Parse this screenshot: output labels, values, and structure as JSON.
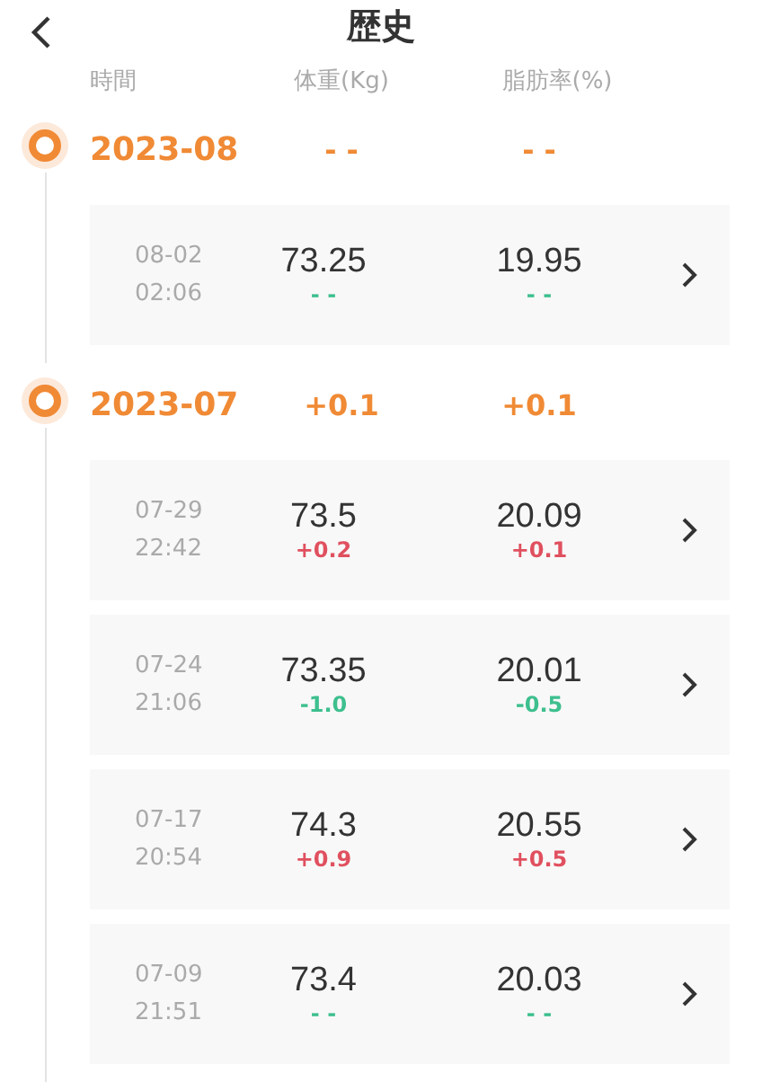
{
  "header": {
    "title": "歴史"
  },
  "columns": [
    "時間",
    "体重(Kg)",
    "脂肪率(%)"
  ],
  "months": [
    {
      "label": "2023-08",
      "weight_change": "- -",
      "fat_change": "- -",
      "entries": [
        {
          "date": "08-02",
          "time": "02:06",
          "weight": "73.25",
          "weight_change": {
            "text": "- -",
            "color": "#3dbf8e"
          },
          "fat": "19.95",
          "fat_change": {
            "text": "- -",
            "color": "#3dbf8e"
          }
        }
      ]
    },
    {
      "label": "2023-07",
      "weight_change": "+0.1",
      "fat_change": "+0.1",
      "entries": [
        {
          "date": "07-29",
          "time": "22:42",
          "weight": "73.5",
          "weight_change": {
            "text": "+0.2",
            "color": "#e0505f"
          },
          "fat": "20.09",
          "fat_change": {
            "text": "+0.1",
            "color": "#e0505f"
          }
        },
        {
          "date": "07-24",
          "time": "21:06",
          "weight": "73.35",
          "weight_change": {
            "text": "-1.0",
            "color": "#3dbf8e"
          },
          "fat": "20.01",
          "fat_change": {
            "text": "-0.5",
            "color": "#3dbf8e"
          }
        },
        {
          "date": "07-17",
          "time": "20:54",
          "weight": "74.3",
          "weight_change": {
            "text": "+0.9",
            "color": "#e0505f"
          },
          "fat": "20.55",
          "fat_change": {
            "text": "+0.5",
            "color": "#e0505f"
          }
        },
        {
          "date": "07-09",
          "time": "21:51",
          "weight": "73.4",
          "weight_change": {
            "text": "- -",
            "color": "#3dbf8e"
          },
          "fat": "20.03",
          "fat_change": {
            "text": "- -",
            "color": "#3dbf8e"
          }
        }
      ]
    }
  ]
}
